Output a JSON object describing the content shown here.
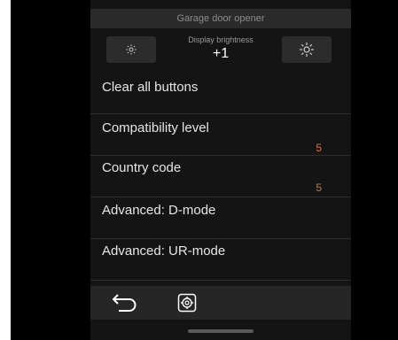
{
  "header": {
    "title": "Garage door opener"
  },
  "brightness": {
    "label": "Display brightness",
    "value": "+1",
    "decrease_icon": "sun-dim-icon",
    "increase_icon": "sun-bright-icon"
  },
  "menu": {
    "items": [
      {
        "label": "Clear all buttons",
        "value": ""
      },
      {
        "label": "Compatibility level",
        "value": "5"
      },
      {
        "label": "Country code",
        "value": "5"
      },
      {
        "label": "Advanced: D-mode",
        "value": ""
      },
      {
        "label": "Advanced: UR-mode",
        "value": ""
      }
    ]
  },
  "bottom_bar": {
    "back_icon": "back-arrow-icon",
    "settings_icon": "settings-gear-icon"
  },
  "colors": {
    "accent": "#e07033",
    "background": "#141414",
    "text": "#e6e6e6"
  }
}
